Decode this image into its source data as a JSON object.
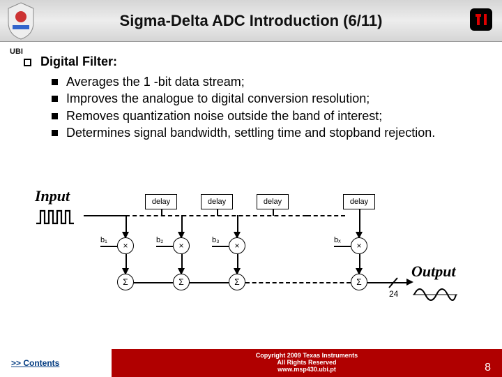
{
  "header": {
    "title": "Sigma-Delta ADC Introduction (6/11)",
    "ubi": "UBI"
  },
  "content": {
    "heading": "Digital Filter:",
    "items": [
      "Averages the 1 -bit data stream;",
      "Improves the analogue to digital conversion resolution;",
      "Removes quantization noise outside the band of interest;",
      "Determines signal bandwidth, settling time and stopband rejection."
    ]
  },
  "diagram": {
    "input_label": "Input",
    "output_label": "Output",
    "delay_label": "delay",
    "coeffs": [
      "b₁",
      "b₂",
      "b₃",
      "bₓ"
    ],
    "mult": "×",
    "sum": "Σ",
    "divider": "24"
  },
  "footer": {
    "contents": ">> Contents",
    "copyright": "Copyright 2009 Texas Instruments",
    "rights": "All Rights Reserved",
    "url": "www.msp430.ubi.pt",
    "page": "8"
  }
}
